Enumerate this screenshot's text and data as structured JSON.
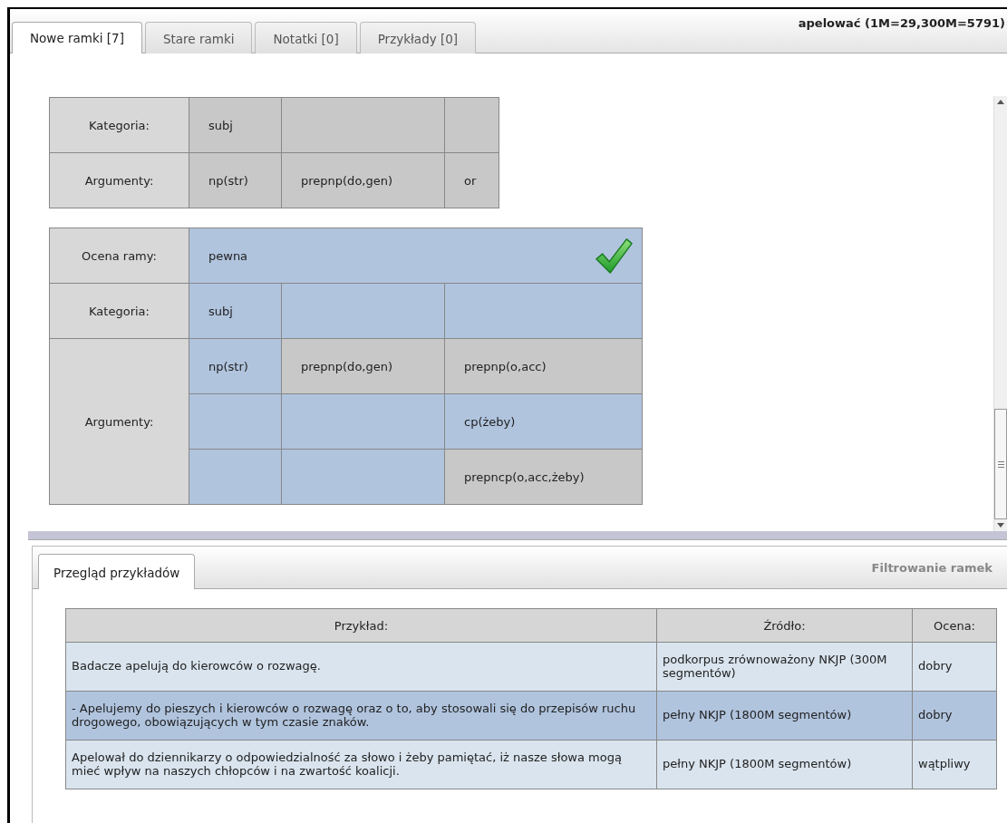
{
  "tabs": [
    {
      "label": "Nowe ramki [7]",
      "selected": true
    },
    {
      "label": "Stare ramki",
      "selected": false
    },
    {
      "label": "Notatki [0]",
      "selected": false
    },
    {
      "label": "Przykłady [0]",
      "selected": false
    }
  ],
  "title": "apelować (1M=29,300M=5791)",
  "frames": [
    {
      "rows": [
        {
          "label": "Kategoria:",
          "cells": [
            [
              {
                "text": "subj",
                "highlighted": false
              },
              {
                "highlighted": false
              },
              {
                "highlighted": false
              }
            ]
          ]
        },
        {
          "label": "Argumenty:",
          "cells": [
            [
              {
                "text": "np(str)",
                "highlighted": false
              },
              {
                "text": "prepnp(do,gen)",
                "highlighted": false
              },
              {
                "text": "or",
                "highlighted": false
              }
            ]
          ]
        }
      ]
    },
    {
      "rating": {
        "label": "Ocena ramy:",
        "text": "pewna",
        "highlighted": true,
        "confirmed": true
      },
      "rows": [
        {
          "label": "Kategoria:",
          "cells": [
            [
              {
                "text": "subj",
                "highlighted": true
              },
              {
                "highlighted": true
              },
              {
                "highlighted": true
              }
            ]
          ]
        },
        {
          "label": "Argumenty:",
          "cells": [
            [
              {
                "text": "np(str)",
                "highlighted": true
              },
              {
                "text": "prepnp(do,gen)",
                "highlighted": false
              },
              {
                "text": "prepnp(o,acc)",
                "highlighted": false
              }
            ],
            [
              {
                "highlighted": true
              },
              {
                "highlighted": true
              },
              {
                "text": "cp(żeby)",
                "highlighted": true
              }
            ],
            [
              {
                "highlighted": true
              },
              {
                "highlighted": true
              },
              {
                "text": "prepncp(o,acc,żeby)",
                "highlighted": false
              }
            ]
          ]
        }
      ]
    }
  ],
  "bottom_tabs": [
    {
      "label": "Przegląd przykładów",
      "selected": true
    }
  ],
  "filter_link": "Filtrowanie ramek",
  "examples": {
    "columns": [
      "Przykład:",
      "Źródło:",
      "Ocena:"
    ],
    "rows": [
      {
        "example": "Badacze apelują do kierowców o rozwagę.",
        "source": "podkorpus zrównoważony NKJP (300M segmentów)",
        "rating": "dobry",
        "selected": false
      },
      {
        "example": "- Apelujemy do pieszych i kierowców o rozwagę oraz o to, aby stosowali się do przepisów ruchu drogowego, obowiązujących w tym czasie znaków.",
        "source": "pełny NKJP (1800M segmentów)",
        "rating": "dobry",
        "selected": true
      },
      {
        "example": "Apelował do dziennikarzy o odpowiedzialność za słowo i żeby pamiętać, iż nasze słowa mogą mieć wpływ na naszych chłopców i na zwartość koalicji.",
        "source": "pełny NKJP (1800M segmentów)",
        "rating": "wątpliwy",
        "selected": false
      }
    ]
  }
}
